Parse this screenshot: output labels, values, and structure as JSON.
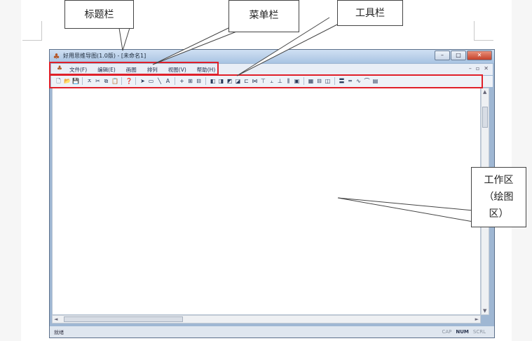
{
  "callouts": {
    "title_bar": "标题栏",
    "menu_bar": "菜单栏",
    "toolbar": "工具栏",
    "workspace": [
      "工作区",
      "（绘图",
      "区）"
    ]
  },
  "window": {
    "title": "好用思维导图(1.0版) - [未命名1]",
    "buttons": {
      "minimize": "–",
      "maximize": "□",
      "close": "✕"
    }
  },
  "menu": {
    "items": [
      "文件(F)",
      "编辑(E)",
      "画图",
      "排列",
      "视图(V)",
      "帮助(H)"
    ],
    "mdi": {
      "minimize": "–",
      "restore": "▫",
      "close": "✕"
    }
  },
  "toolbar": {
    "groups": [
      [
        "new-icon",
        "open-icon",
        "save-icon"
      ],
      [
        "cut-icon",
        "scissors-icon",
        "copy-icon",
        "paste-icon"
      ],
      [
        "help-icon"
      ],
      [
        "pointer-icon",
        "rectangle-icon",
        "line-icon",
        "text-icon"
      ],
      [
        "plus-icon",
        "grid-icon",
        "split-icon"
      ],
      [
        "bring-front-icon",
        "send-back-icon",
        "layer-up-icon",
        "layer-down-icon",
        "align-left-icon",
        "align-center-icon",
        "align-top-icon",
        "align-middle-icon",
        "align-bottom-icon",
        "distribute-icon",
        "group-icon"
      ],
      [
        "table-icon",
        "frame-icon",
        "box-icon"
      ],
      [
        "bold-line-icon",
        "double-line-icon",
        "curve-icon",
        "arc-icon",
        "image-icon"
      ]
    ],
    "glyphs": {
      "new-icon": "🗋",
      "open-icon": "📂",
      "save-icon": "💾",
      "cut-icon": "ㅈ",
      "scissors-icon": "✂",
      "copy-icon": "⧉",
      "paste-icon": "📋",
      "help-icon": "❓",
      "pointer-icon": "➤",
      "rectangle-icon": "▭",
      "line-icon": "╲",
      "text-icon": "A",
      "plus-icon": "+",
      "grid-icon": "⊞",
      "split-icon": "⊟",
      "bring-front-icon": "◧",
      "send-back-icon": "◨",
      "layer-up-icon": "◩",
      "layer-down-icon": "◪",
      "align-left-icon": "⊏",
      "align-center-icon": "⋈",
      "align-top-icon": "⊤",
      "align-middle-icon": "⫠",
      "align-bottom-icon": "⊥",
      "distribute-icon": "⫼",
      "group-icon": "▣",
      "table-icon": "▦",
      "frame-icon": "⊟",
      "box-icon": "◫",
      "bold-line-icon": "〓",
      "double-line-icon": "═",
      "curve-icon": "∿",
      "arc-icon": "⌒",
      "image-icon": "▤"
    }
  },
  "scroll": {
    "up": "▲",
    "down": "▼",
    "left": "◄",
    "right": "►",
    "grip": "≡",
    "hgrip": "⦙⦙⦙"
  },
  "status": {
    "left": "就绪",
    "indicators": [
      {
        "label": "CAP",
        "on": false
      },
      {
        "label": "NUM",
        "on": true
      },
      {
        "label": "SCRL",
        "on": false
      }
    ]
  }
}
